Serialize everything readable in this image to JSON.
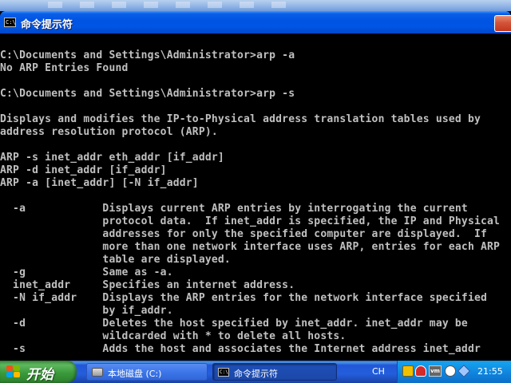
{
  "window": {
    "title": "命令提示符",
    "title_icon_text": "C:\\"
  },
  "console": {
    "lines": [
      "C:\\Documents and Settings\\Administrator>arp -a",
      "No ARP Entries Found",
      "",
      "C:\\Documents and Settings\\Administrator>arp -s",
      "",
      "Displays and modifies the IP-to-Physical address translation tables used by",
      "address resolution protocol (ARP).",
      "",
      "ARP -s inet_addr eth_addr [if_addr]",
      "ARP -d inet_addr [if_addr]",
      "ARP -a [inet_addr] [-N if_addr]",
      "",
      "  -a            Displays current ARP entries by interrogating the current",
      "                protocol data.  If inet_addr is specified, the IP and Physical",
      "                addresses for only the specified computer are displayed.  If",
      "                more than one network interface uses ARP, entries for each ARP",
      "                table are displayed.",
      "  -g            Same as -a.",
      "  inet_addr     Specifies an internet address.",
      "  -N if_addr    Displays the ARP entries for the network interface specified",
      "                by if_addr.",
      "  -d            Deletes the host specified by inet_addr. inet_addr may be",
      "                wildcarded with * to delete all hosts.",
      "  -s            Adds the host and associates the Internet address inet_addr"
    ]
  },
  "taskbar": {
    "start_label": "开始",
    "tasks": [
      {
        "label": "本地磁盘 (C:)",
        "icon": "disk-icon",
        "active": false
      },
      {
        "label": "命令提示符",
        "icon": "cmd-icon",
        "active": true
      }
    ],
    "language": "CH",
    "tray_icons": [
      "input-method-icon",
      "security-alert-icon",
      "vmware-icon",
      "sound-icon",
      "network-icon"
    ],
    "clock": "21:55"
  },
  "colors": {
    "console_text": "#c0c0c0",
    "console_background": "#000000",
    "titlebar": "#0054e3",
    "taskbar": "#245edc",
    "start_button": "#3a9a3a"
  }
}
